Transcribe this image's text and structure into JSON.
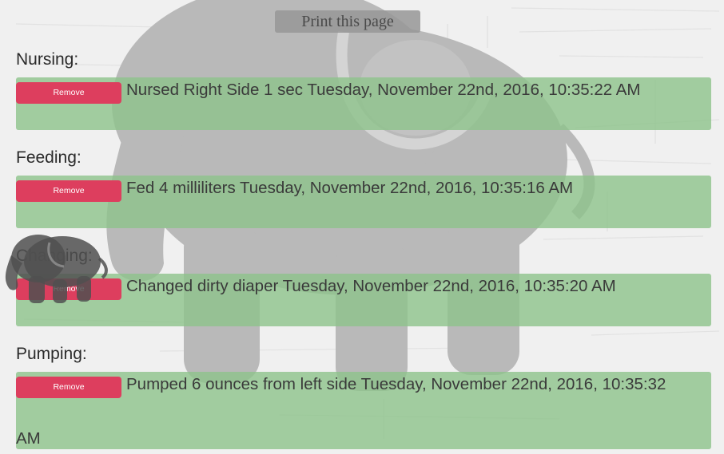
{
  "toolbar": {
    "print_label": "Print this page"
  },
  "sections": [
    {
      "title": "Nursing:",
      "remove_label": "Remove",
      "entry": "Nursed Right Side 1 sec Tuesday, November 22nd, 2016, 10:35:22 AM"
    },
    {
      "title": "Feeding:",
      "remove_label": "Remove",
      "entry": "Fed 4 milliliters Tuesday, November 22nd, 2016, 10:35:16 AM"
    },
    {
      "title": "Changing:",
      "remove_label": "Remove",
      "entry": "Changed dirty diaper Tuesday, November 22nd, 2016, 10:35:20 AM"
    },
    {
      "title": "Pumping:",
      "remove_label": "Remove",
      "entry_line1": "Pumped 6 ounces from left side Tuesday, November 22nd, 2016, 10:35:32",
      "entry_line2": "AM"
    }
  ],
  "colors": {
    "entry_background": "#8fc38c",
    "remove_button": "#dd3e5e",
    "print_button": "#969696",
    "elephant": "#b4b4b4"
  }
}
